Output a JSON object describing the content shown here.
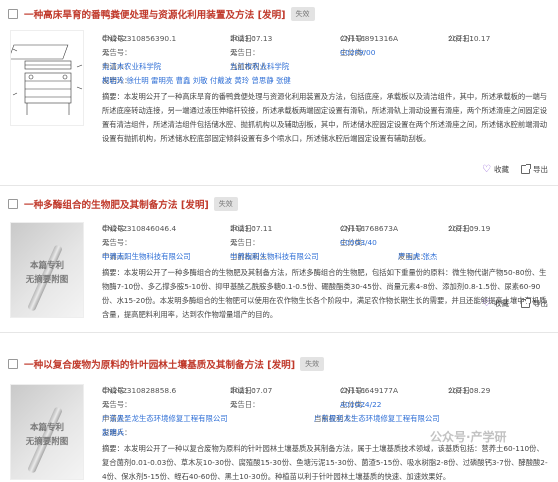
{
  "labels": {
    "app_no": "申请号：",
    "app_date": "申请日：",
    "pub_no": "公开号：",
    "pub_date": "公开日：",
    "ann_no": "公告号：",
    "ann_date": "公告日：",
    "main_class": "主分类：",
    "applicant": "申请人：",
    "current_owner": "当前权利人：",
    "inventor": "发明人：",
    "abstract": "摘要：",
    "collect": "收藏",
    "export": "导出"
  },
  "thumb_placeholder": {
    "line1": "本篇专利",
    "line2": "无摘要附图"
  },
  "records": [
    {
      "title": "一种高床旱育的番鸭粪便处理与资源化利用装置及方法 [发明]",
      "status": "失效",
      "app_no": "CN202310856390.1",
      "app_date": "2023.07.13",
      "pub_no": "CN116891316A",
      "pub_date": "2023.10.17",
      "ann_no": "无",
      "ann_date": "无",
      "main_class": "C02F9/00",
      "applicant": "九江市农业科学院",
      "current_owner": "九江市农业科学院",
      "inventor": "柯岩玲 徐仕明 雷明亮 曹鑫 刘敬 付戴波 黄玲 曾思静 张健",
      "abstract": "本发明公开了一种高床旱育的番鸭粪便处理与资源化利用装置及方法，包括底座，承载板以及清洁组件，其中，所述承载板的一端与所述底座转动连接，另一端通过液压伸缩杆铰接，所述承载板两端固定设置有滑轨，所述滑轨上滑动设置有滑座，两个所述滑座之间固定设置有清洁组件，所述清洁组件包括储水腔、抛抓机构以及辅助刮板，其中，所述储水腔固定设置在两个所述滑座之间，所述储水腔前端滑动设置有抛抓机构，所述储水腔底部固定倾斜设置有多个喷水口，所述储水腔后端固定设置有辅助刮板。",
      "thumb": "drawing"
    },
    {
      "title": "一种多酶组合的生物肥及其制备方法 [发明]",
      "status": "失效",
      "app_no": "CN202310846046.4",
      "app_date": "2023.07.11",
      "pub_no": "CN116768673A",
      "pub_date": "2023.09.19",
      "ann_no": "无",
      "ann_date": "无",
      "main_class": "C05G3/40",
      "applicant": "中界南阳生物科技有限公司",
      "current_owner": "中界南阳生物科技有限公司",
      "inventor": "严玉虎 张杰",
      "abstract": "本发明公开了一种多酶组合的生物肥及其制备方法，所述多酶组合的生物肥，包括如下重量份的原料：微生物代谢产物50-80份、生物酶7-10份、多乙撑多胺5-10份、抑甲基酰乙酰胺多糖0.1-0.5份、硼酸酯类30-45份、尚量元素4-8份、添加剂0.8-1.5份、尿素60-90份、水15-20份。本发明多酶组合的生物肥可以使用在农作物生长各个阶段中，满足农作物长期生长的需要，并且还能够提高土壤中有机质含量，提高肥料利用率，达到农作物增量增产的目的。",
      "thumb": "placeholder"
    },
    {
      "title": "一种以复合废物为原料的针叶园林土壤基质及其制备方法 [发明]",
      "status": "失效",
      "app_no": "CN202310828858.6",
      "app_date": "2023.07.07",
      "pub_no": "CN116649177A",
      "pub_date": "2023.08.29",
      "ann_no": "无",
      "ann_date": "无",
      "main_class": "A01G24/22",
      "applicant": "广东曼圣龙生态环境修复工程有限公司",
      "current_owner": "广东曼圣龙生态环境修复工程有限公司",
      "inventor": "彭建兵",
      "abstract": "本发明公开了一种以复合废物为原料的针叶园林土壤基质及其制备方法，属于土壤基质技术领域，该基质包括：营养土60-110份、复合菌剂0.01-0.03份、草木灰10-30份、腐殖酸15-30份、鱼塘污泥15-30份、菌渣5-15份、吸水树脂2-8份、过磷酸钙3-7份、酵酸酸2-4份、保水剂5-15份、蛭石40-60份、黑土10-30份。种植苗以利于针叶园林土壤基质的快速、加速效果好。",
      "thumb": "placeholder"
    }
  ],
  "watermark": "公众号·产学研"
}
